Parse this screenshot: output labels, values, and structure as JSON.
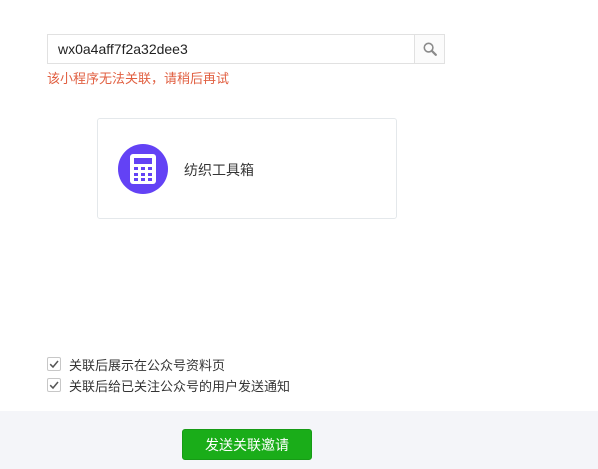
{
  "search": {
    "value": "wx0a4aff7f2a32dee3",
    "icon": "search-icon"
  },
  "error_message": "该小程序无法关联，请稍后再试",
  "result_card": {
    "app_name": "纺织工具箱",
    "icon": "calculator-icon",
    "avatar_color": "#6342f5"
  },
  "options": [
    {
      "label": "关联后展示在公众号资料页",
      "checked": true
    },
    {
      "label": "关联后给已关注公众号的用户发送通知",
      "checked": true
    }
  ],
  "footer": {
    "submit_label": "发送关联邀请",
    "submit_color": "#1aad19"
  }
}
